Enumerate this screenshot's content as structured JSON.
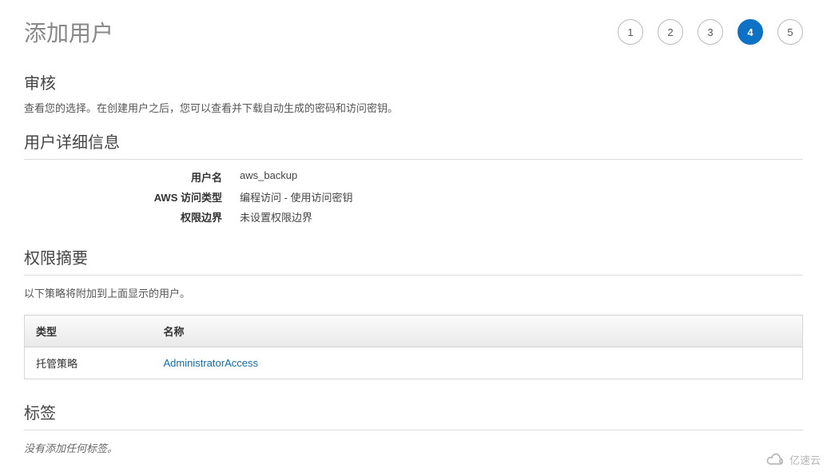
{
  "page": {
    "title": "添加用户"
  },
  "stepper": {
    "steps": [
      "1",
      "2",
      "3",
      "4",
      "5"
    ],
    "active": "4"
  },
  "review": {
    "heading": "审核",
    "description": "查看您的选择。在创建用户之后，您可以查看并下载自动生成的密码和访问密钥。"
  },
  "details": {
    "heading": "用户详细信息",
    "rows": [
      {
        "label": "用户名",
        "value": "aws_backup"
      },
      {
        "label": "AWS 访问类型",
        "value": "编程访问 - 使用访问密钥"
      },
      {
        "label": "权限边界",
        "value": "未设置权限边界"
      }
    ]
  },
  "permissions": {
    "heading": "权限摘要",
    "description": "以下策略将附加到上面显示的用户。",
    "table": {
      "headers": {
        "type": "类型",
        "name": "名称"
      },
      "rows": [
        {
          "type": "托管策略",
          "name": "AdministratorAccess"
        }
      ]
    }
  },
  "tags": {
    "heading": "标签",
    "emptyText": "没有添加任何标签。"
  },
  "watermark": "亿速云"
}
